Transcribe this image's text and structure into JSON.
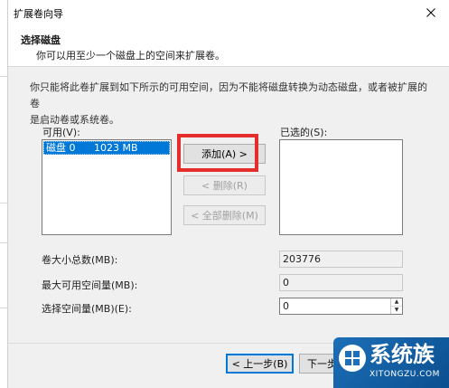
{
  "window": {
    "title": "扩展卷向导"
  },
  "header": {
    "title": "选择磁盘",
    "subtitle": "你可以用至少一个磁盘上的空间来扩展卷。"
  },
  "description": {
    "line1": "你只能将此卷扩展到如下所示的可用空间，因为不能将磁盘转换为动态磁盘，或者被扩展的卷",
    "line2": "是启动卷或系统卷。"
  },
  "available": {
    "label": "可用(V):",
    "items": [
      {
        "disk": "磁盘 0",
        "size": "1023 MB"
      }
    ]
  },
  "selected": {
    "label": "已选的(S):",
    "items": []
  },
  "buttons": {
    "add": "添加(A) >",
    "remove": "< 删除(R)",
    "remove_all": "< 全部删除(M)",
    "back": "< 上一步(B)",
    "next": "下一步"
  },
  "fields": {
    "total_label": "卷大小总数(MB):",
    "total_value": "203776",
    "max_label": "最大可用空间量(MB):",
    "max_value": "0",
    "select_label": "选择空间量(MB)(E):",
    "select_value": "0"
  },
  "watermark": {
    "brand": "系统族",
    "url": "XITONGZU.COM"
  },
  "colors": {
    "selection": "#0078d7",
    "highlight": "#e52d2d",
    "watermark": "#1c6fb8"
  }
}
